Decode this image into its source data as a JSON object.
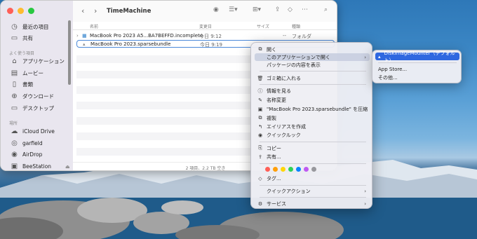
{
  "finder": {
    "title": "TimeMachine",
    "sidebar": {
      "items_top": [
        {
          "label": "最近の項目",
          "icon": "clock-icon"
        },
        {
          "label": "共有",
          "icon": "shared-folder-icon"
        }
      ],
      "favorites_header": "よく使う項目",
      "favorites": [
        {
          "label": "アプリケーション",
          "icon": "applications-icon"
        },
        {
          "label": "ムービー",
          "icon": "film-icon"
        },
        {
          "label": "書類",
          "icon": "document-icon"
        },
        {
          "label": "ダウンロード",
          "icon": "download-icon"
        },
        {
          "label": "デスクトップ",
          "icon": "desktop-icon"
        }
      ],
      "locations_header": "場所",
      "locations": [
        {
          "label": "iCloud Drive",
          "icon": "cloud-icon"
        },
        {
          "label": "garfield",
          "icon": "network-icon"
        },
        {
          "label": "AirDrop",
          "icon": "airdrop-icon"
        },
        {
          "label": "BeeStation",
          "icon": "server-icon"
        }
      ]
    },
    "columns": {
      "name": "名前",
      "date": "変更日",
      "size": "サイズ",
      "kind": "種類"
    },
    "files": [
      {
        "name": "MacBook Pro 2023 A5...BA7BEFFD.incomplete",
        "date": "今日 9:12",
        "size": "--",
        "kind": "フォルダ"
      },
      {
        "name": "MacBook Pro 2023.sparsebundle",
        "date": "今日 9:19",
        "size": "",
        "kind": ""
      }
    ],
    "status": "2 項目、2.2 TB 空き"
  },
  "context_menu": {
    "open": "開く",
    "open_with": "このアプリケーションで開く",
    "show_package": "パッケージの内容を表示",
    "trash": "ゴミ箱に入れる",
    "get_info": "情報を見る",
    "rename": "名称変更",
    "compress": "\"MacBook Pro 2023.sparsebundle\" を圧縮",
    "duplicate": "複製",
    "make_alias": "エイリアスを作成",
    "quick_look": "クイックルック",
    "copy": "コピー",
    "share": "共有...",
    "tags": "タグ...",
    "quick_actions": "クイックアクション",
    "services": "サービス",
    "tag_colors": [
      "#ff5f57",
      "#ff9f0a",
      "#ffd60a",
      "#30d158",
      "#0a84ff",
      "#bf5af2",
      "#98989d"
    ]
  },
  "submenu": {
    "default_app": "DiskImageMounter（デフォルト）",
    "app_store": "App Store...",
    "other": "その他..."
  }
}
